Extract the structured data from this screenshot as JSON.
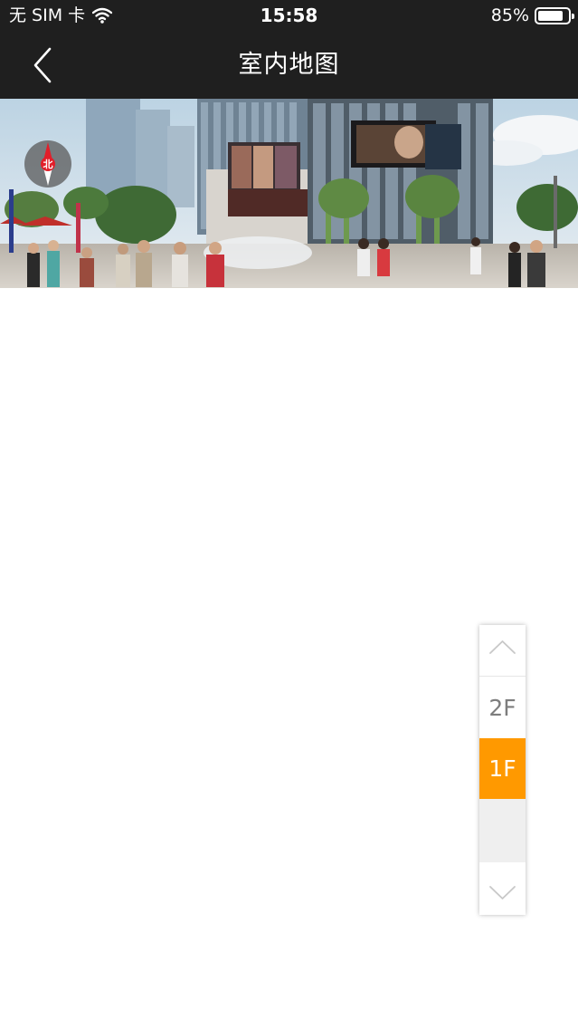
{
  "status_bar": {
    "carrier": "无 SIM 卡",
    "time": "15:58",
    "battery_percent": "85%",
    "battery_level": 0.85
  },
  "nav": {
    "title": "室内地图",
    "back_icon": "chevron-left-icon"
  },
  "banner": {
    "compass_label": "北",
    "icon": "compass-icon"
  },
  "floor_selector": {
    "up_icon": "chevron-up-icon",
    "down_icon": "chevron-down-icon",
    "floors": [
      "2F",
      "1F"
    ],
    "selected": "1F",
    "accent_color": "#ff9900"
  },
  "colors": {
    "header_bg": "#1f1f1f",
    "accent": "#ff9900"
  }
}
